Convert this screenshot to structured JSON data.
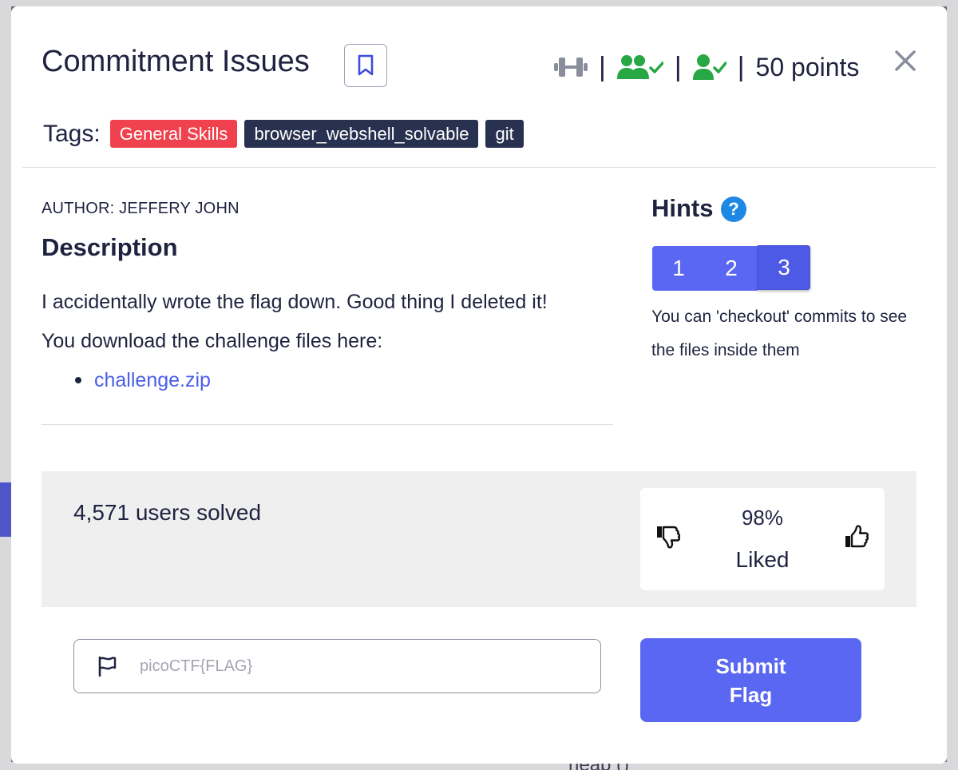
{
  "challenge": {
    "title": "Commitment Issues",
    "points": "50 points",
    "separators": [
      "|",
      "|",
      "|"
    ],
    "author": "AUTHOR: JEFFERY JOHN"
  },
  "tags": {
    "label": "Tags:",
    "items": [
      {
        "label": "General Skills",
        "color": "#f0424e"
      },
      {
        "label": "browser_webshell_solvable",
        "color": "#28314f"
      },
      {
        "label": "git",
        "color": "#28314f"
      }
    ]
  },
  "description": {
    "heading": "Description",
    "line1": "I accidentally wrote the flag down. Good thing I deleted it!",
    "line2": "You download the challenge files here:",
    "link": "challenge.zip"
  },
  "hints": {
    "heading": "Hints",
    "help_icon": "?",
    "buttons": [
      "1",
      "2",
      "3"
    ],
    "active_index": 2,
    "text": "You can 'checkout' commits to see the files inside them"
  },
  "stats": {
    "solved": "4,571 users solved",
    "liked_percent": "98%",
    "liked_label": "Liked"
  },
  "flag_form": {
    "placeholder": "picoCTF{FLAG}",
    "value": "",
    "submit_label": "Submit Flag"
  },
  "background": {
    "fragment": "heap ()"
  },
  "colors": {
    "accent": "#5a67f2",
    "success_green": "#28a745",
    "link": "#4a5ee8",
    "tag_red": "#f0424e",
    "tag_dark": "#28314f",
    "help_blue": "#1e88e5"
  },
  "icons": [
    "bookmark-icon",
    "dumbbell-icon",
    "users-check-icon",
    "user-check-icon",
    "close-icon",
    "help-icon",
    "thumbs-down-icon",
    "thumbs-up-icon",
    "flag-icon"
  ]
}
